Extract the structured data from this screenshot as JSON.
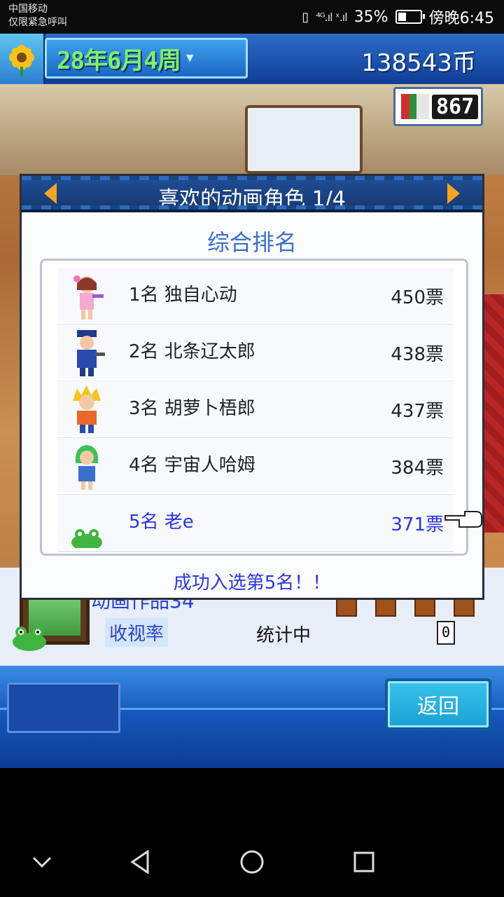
{
  "status_bar": {
    "carrier_line1": "中国移动",
    "carrier_line2": "仅限紧急呼叫",
    "signal": "⁴ᴳ.ıl ˣ.ıl",
    "battery": "35%",
    "battery_level": 0.35,
    "time": "傍晚6:45"
  },
  "top_bar": {
    "date": "28年6月4周",
    "money": "138543币",
    "icon": "sunflower-icon"
  },
  "scene": {
    "counter": "867"
  },
  "dialog": {
    "title": "喜欢的动画角色 1/4",
    "subtitle": "综合排名",
    "rankings": [
      {
        "rank": "1名 独自心动",
        "votes": "450票"
      },
      {
        "rank": "2名 北条辽太郎",
        "votes": "438票"
      },
      {
        "rank": "3名 胡萝卜梧郎",
        "votes": "437票"
      },
      {
        "rank": "4名 宇宙人哈姆",
        "votes": "384票"
      },
      {
        "rank": "5名 老e",
        "votes": "371票"
      }
    ],
    "message": "成功入选第5名！！"
  },
  "info": {
    "anime_title": "动画作品34",
    "rating_label": "收视率",
    "rating_value": "统计中",
    "small_counter": "0"
  },
  "action_bar": {
    "back_label": "返回"
  },
  "colors": {
    "accent_blue": "#2c35e0",
    "header_blue": "#1f4f99",
    "arrow_orange": "#f5a423"
  }
}
